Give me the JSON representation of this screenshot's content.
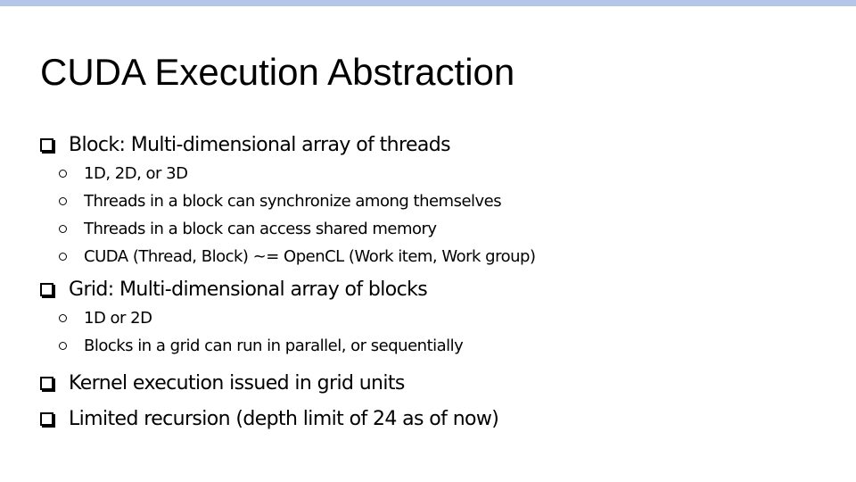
{
  "slide": {
    "title": "CUDA Execution Abstraction",
    "accent_color": "#b4c6e7",
    "bullets": [
      {
        "text": "Block: Multi-dimensional array of threads",
        "icon": "checkbox-square-icon",
        "sub": [
          {
            "text": "1D, 2D, or 3D",
            "icon": "hollow-circle-icon"
          },
          {
            "text": "Threads in a block can synchronize among themselves",
            "icon": "hollow-circle-icon"
          },
          {
            "text": "Threads in a block can access shared memory",
            "icon": "hollow-circle-icon"
          },
          {
            "text": "CUDA (Thread, Block) ~= OpenCL (Work item, Work group)",
            "icon": "hollow-circle-icon"
          }
        ]
      },
      {
        "text": "Grid: Multi-dimensional array of blocks",
        "icon": "checkbox-square-icon",
        "sub": [
          {
            "text": "1D or 2D",
            "icon": "hollow-circle-icon"
          },
          {
            "text": "Blocks in a grid can run in parallel, or sequentially",
            "icon": "hollow-circle-icon"
          }
        ]
      },
      {
        "text": "Kernel execution issued in grid units",
        "icon": "checkbox-square-icon",
        "sub": []
      },
      {
        "text": "Limited recursion (depth limit of 24 as of now)",
        "icon": "checkbox-square-icon",
        "sub": []
      }
    ]
  }
}
